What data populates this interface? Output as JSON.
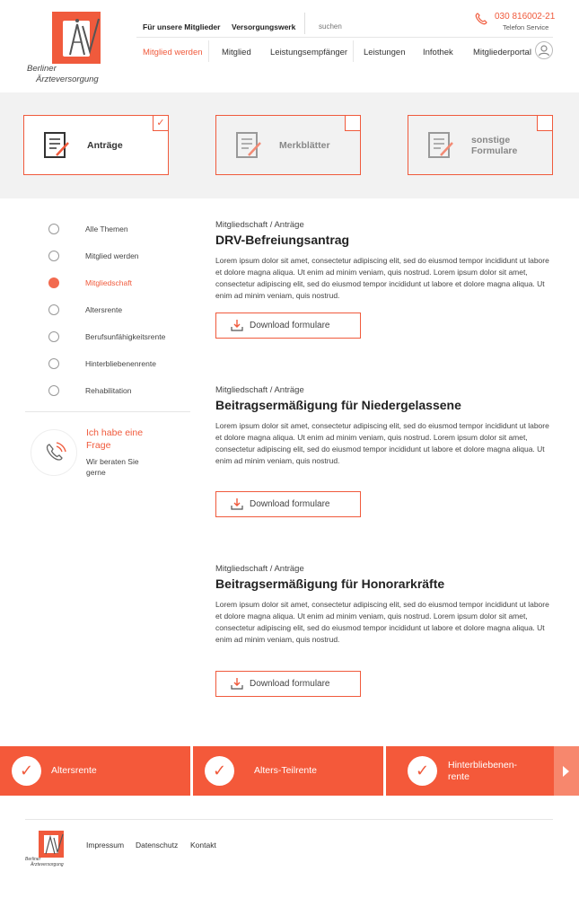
{
  "logo": {
    "line1": "Berliner",
    "line2": "Ärzteversorgung"
  },
  "topnav": {
    "members": "Für unsere Mitglieder",
    "fund": "Versorgungswerk",
    "search_placeholder": "suchen"
  },
  "service": {
    "phone": "030 816002-21",
    "label": "Telefon Service"
  },
  "mainnav": [
    "Mitglied werden",
    "Mitglied",
    "Leistungsempfänger",
    "Leistungen",
    "Infothek",
    "Mitgliederportal"
  ],
  "categories": [
    {
      "label": "Anträge",
      "active": true,
      "check": "✓"
    },
    {
      "label": "Merkblätter",
      "active": false
    },
    {
      "label_line1": "sonstige",
      "label_line2": "Formulare",
      "active": false
    }
  ],
  "sidebar": {
    "items": [
      "Alle Themen",
      "Mitglied werden",
      "Mitgliedschaft",
      "Altersrente",
      "Berufsunfähigkeitsrente",
      "Hinterbliebenenrente",
      "Rehabilitation"
    ],
    "active_index": 2,
    "help_title": "Ich habe eine Frage",
    "help_sub": "Wir beraten Sie gerne"
  },
  "articles": [
    {
      "crumb": "Mitgliedschaft / Anträge",
      "title": "DRV-Befreiungsantrag",
      "body": "Lorem ipsum dolor sit amet, consectetur adipiscing elit, sed do eiusmod tempor incididunt ut labore et dolore magna aliqua. Ut enim ad minim veniam, quis nostrud. Lorem ipsum dolor sit amet, consectetur adipiscing elit, sed do eiusmod tempor incididunt ut labore et dolore magna aliqua. Ut enim ad minim veniam, quis nostrud.",
      "button": "Download formulare"
    },
    {
      "crumb": "Mitgliedschaft / Anträge",
      "title": "Beitragsermäßigung für Niedergelassene",
      "body": "Lorem ipsum dolor sit amet, consectetur adipiscing elit, sed do eiusmod tempor incididunt ut labore et dolore magna aliqua. Ut enim ad minim veniam, quis nostrud. Lorem ipsum dolor sit amet, consectetur adipiscing elit, sed do eiusmod tempor incididunt ut labore et dolore magna aliqua. Ut enim ad minim veniam, quis nostrud.",
      "button": "Download formulare"
    },
    {
      "crumb": "Mitgliedschaft / Anträge",
      "title": "Beitragsermäßigung für Honorarkräfte",
      "body": "Lorem ipsum dolor sit amet, consectetur adipiscing elit, sed do eiusmod tempor incididunt ut labore et dolore magna aliqua. Ut enim ad minim veniam, quis nostrud. Lorem ipsum dolor sit amet, consectetur adipiscing elit, sed do eiusmod tempor incididunt ut labore et dolore magna aliqua. Ut enim ad minim veniam, quis nostrud.",
      "button": "Download formulare"
    }
  ],
  "quicklinks": [
    {
      "label": "Altersrente",
      "check": "✓"
    },
    {
      "label": "Alters-Teilrente",
      "check": "✓"
    },
    {
      "label_line1": "Hinterbliebenen-",
      "label_line2": "rente",
      "check": "✓"
    }
  ],
  "footer": {
    "links": [
      "Impressum",
      "Datenschutz",
      "Kontakt"
    ],
    "logo_line1": "Berliner",
    "logo_line2": "Ärzteversorgung"
  },
  "colors": {
    "accent": "#f05a3c",
    "band": "#f2f2f2",
    "bar": "#f4593a"
  }
}
